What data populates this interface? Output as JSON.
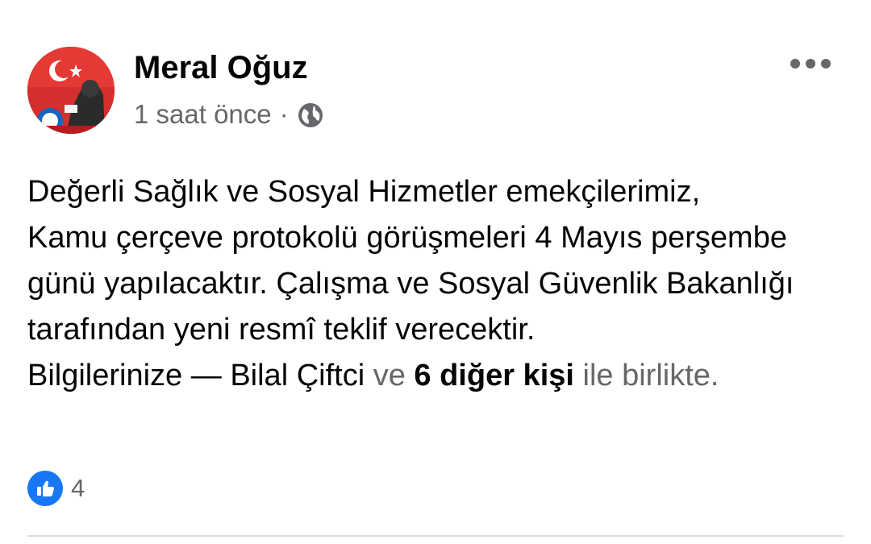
{
  "header": {
    "author_name": "Meral Oğuz",
    "timestamp": "1 saat önce",
    "separator": "·",
    "privacy_icon": "globe-icon",
    "more_icon": "more-horizontal-icon"
  },
  "post": {
    "lines": [
      "Değerli Sağlık ve Sosyal Hizmetler emekçilerimiz,",
      "Kamu çerçeve protokolü görüşmeleri 4 Mayıs perşembe günü yapılacaktır. Çalışma ve Sosyal Güvenlik Bakanlığı tarafından yeni resmî teklif verecektir."
    ],
    "tag_line": {
      "prefix": "Bilgilerinize",
      "dash": "—",
      "tagged_person": "Bilal Çiftci",
      "conjunction": "ve",
      "others": "6 diğer kişi",
      "suffix": "ile birlikte."
    }
  },
  "reactions": {
    "icon": "like-icon",
    "count": "4"
  },
  "colors": {
    "primary_text": "#050505",
    "secondary_text": "#65676b",
    "like_blue": "#1877f2",
    "divider": "#dadde1"
  }
}
